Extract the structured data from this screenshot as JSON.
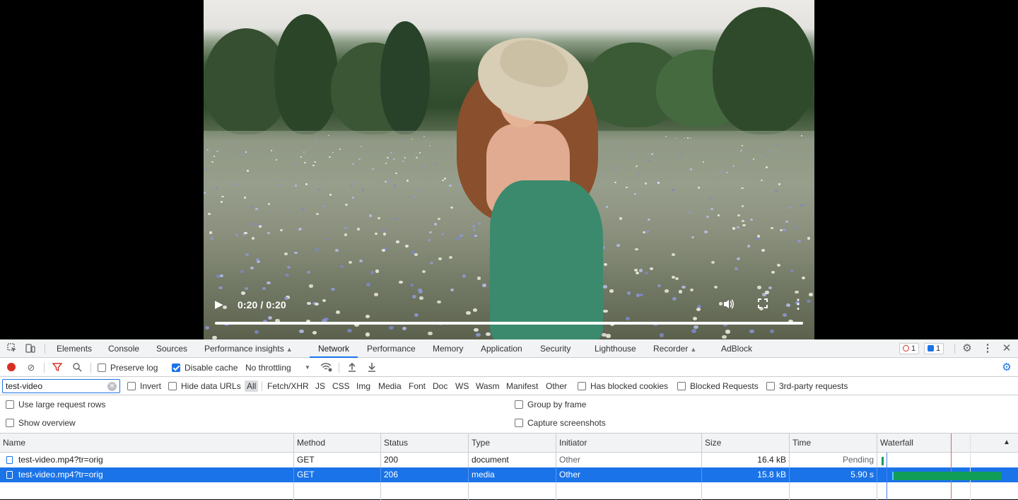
{
  "video": {
    "time_display": "0:20 / 0:20",
    "progress": 1.0,
    "icons": [
      "play-icon",
      "volume-icon",
      "fullscreen-icon",
      "more-vert-icon"
    ]
  },
  "devtools": {
    "tabs": [
      {
        "label": "Elements"
      },
      {
        "label": "Console"
      },
      {
        "label": "Sources"
      },
      {
        "label": "Performance insights",
        "experimental": true
      },
      {
        "label": "Network",
        "active": true
      },
      {
        "label": "Performance"
      },
      {
        "label": "Memory"
      },
      {
        "label": "Application"
      },
      {
        "label": "Security"
      },
      {
        "label": "Lighthouse"
      },
      {
        "label": "Recorder",
        "experimental": true
      },
      {
        "label": "AdBlock"
      }
    ],
    "badges": {
      "errors": "1",
      "messages": "1"
    },
    "toolbar": {
      "preserve_log": "Preserve log",
      "disable_cache": "Disable cache",
      "throttling": "No throttling"
    },
    "filter": {
      "value": "test-video",
      "invert": "Invert",
      "hide_data_urls": "Hide data URLs",
      "types": [
        "All",
        "Fetch/XHR",
        "JS",
        "CSS",
        "Img",
        "Media",
        "Font",
        "Doc",
        "WS",
        "Wasm",
        "Manifest",
        "Other"
      ],
      "active_type": "All",
      "has_blocked_cookies": "Has blocked cookies",
      "blocked_requests": "Blocked Requests",
      "third_party": "3rd-party requests"
    },
    "settings": {
      "large_rows": "Use large request rows",
      "show_overview": "Show overview",
      "group_by_frame": "Group by frame",
      "capture_screenshots": "Capture screenshots"
    },
    "table": {
      "columns": [
        "Name",
        "Method",
        "Status",
        "Type",
        "Initiator",
        "Size",
        "Time",
        "Waterfall"
      ],
      "rows": [
        {
          "name": "test-video.mp4?tr=orig",
          "method": "GET",
          "status": "200",
          "type": "document",
          "initiator": "Other",
          "size": "16.4 kB",
          "time": "Pending"
        },
        {
          "name": "test-video.mp4?tr=orig",
          "method": "GET",
          "status": "206",
          "type": "media",
          "initiator": "Other",
          "size": "15.8 kB",
          "time": "5.90 s",
          "selected": true
        }
      ]
    },
    "colors": {
      "accent": "#1a73e8",
      "waterfall_bar": "#0f9d58",
      "record": "#d93025"
    }
  }
}
